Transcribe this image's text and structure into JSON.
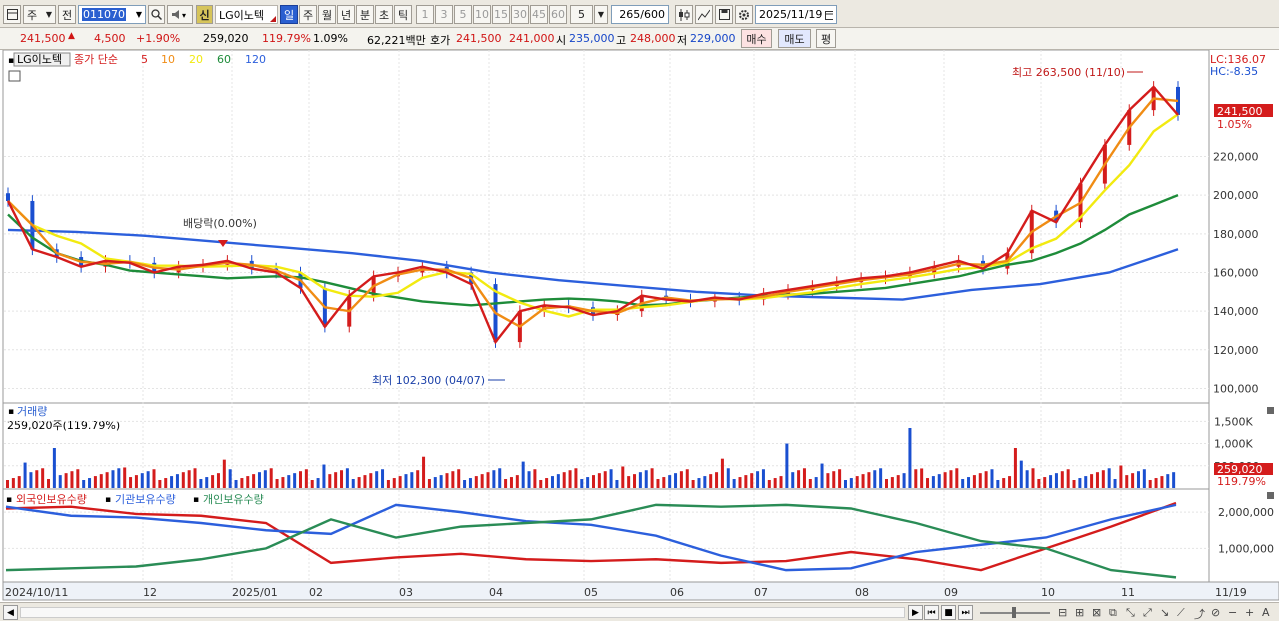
{
  "toolbar": {
    "period_label": "주",
    "prev_label": "전",
    "code_value": "011070",
    "stock_label": "신",
    "stock_name": "LG이노텍",
    "period_buttons": [
      "일",
      "주",
      "월",
      "년",
      "분",
      "초",
      "틱"
    ],
    "minute_buttons": [
      "1",
      "3",
      "5",
      "10",
      "15",
      "30",
      "45",
      "60"
    ],
    "count_value": "5",
    "count_display": "265",
    "count_total": "/600",
    "date_value": "2025/11/19"
  },
  "quote": {
    "price": "241,500",
    "change": "4,500",
    "change_pct": "+1.90%",
    "volume": "259,020",
    "volume_ratio": "119.79%",
    "turnover_pct": "1.09%",
    "amount": "62,221백만",
    "ask_label": "호가",
    "ask": "241,500",
    "bid": "241,000",
    "open_label": "시",
    "open": "235,000",
    "high_label": "고",
    "high": "248,000",
    "low_label": "저",
    "low": "229,000",
    "buy_label": "매수",
    "sell_label": "매도",
    "eval_label": "평"
  },
  "chart": {
    "legend_name": "LG이노텍",
    "legend_type": "종가 단순",
    "ma_periods": [
      "5",
      "10",
      "20",
      "60",
      "120"
    ],
    "ma_colors": [
      "#d41c1c",
      "#f08c14",
      "#f2ea10",
      "#1e8c3a",
      "#2c5fdc"
    ],
    "lc_label": "LC:136.07",
    "hc_label": "HC:-8.35",
    "current_tag": "241,500",
    "current_pct": "1.05%",
    "max_label": "최고 263,500 (11/10)",
    "min_label": "최저 102,300 (04/07)",
    "dividend_label": "배당락(0.00%)",
    "volume_title": "거래량",
    "volume_value": "259,020주(119.79%)",
    "volume_tag": "259,020",
    "volume_tag_pct": "119.79%",
    "holdings_legend": [
      "외국인보유수량",
      "기관보유수량",
      "개인보유수량"
    ],
    "holdings_colors": [
      "#d41c1c",
      "#2c5fdc",
      "#2a8c56"
    ],
    "dates": [
      "2024/10/11",
      "12",
      "2025/01",
      "02",
      "03",
      "04",
      "05",
      "06",
      "07",
      "08",
      "09",
      "10",
      "11",
      "11/19"
    ]
  },
  "chart_data": [
    {
      "type": "candlestick",
      "title": "LG이노텍",
      "yticks": [
        100000,
        120000,
        140000,
        160000,
        180000,
        200000,
        220000
      ],
      "ylim": [
        93000,
        272000
      ],
      "series": [
        {
          "name": "5",
          "values": [
            197000,
            172000,
            168000,
            163000,
            166000,
            165000,
            160000,
            163000,
            164000,
            166000,
            162000,
            160000,
            152000,
            132000,
            148000,
            158000,
            160000,
            163000,
            160000,
            154000,
            124000,
            140000,
            143000,
            142000,
            138000,
            140000,
            148000,
            146000,
            145000,
            147000,
            146000,
            149000,
            151000,
            153000,
            155000,
            157000,
            158000,
            160000,
            163000,
            166000,
            162000,
            170000,
            192000,
            186000,
            206000,
            226000,
            244000,
            256000,
            241500
          ]
        },
        {
          "name": "120",
          "values": [
            182000,
            181000,
            179000,
            176000,
            173000,
            170000,
            166000,
            160000,
            156000,
            153000,
            150000,
            148000,
            147000,
            146000,
            151000,
            154000,
            160000,
            172000
          ]
        }
      ]
    },
    {
      "type": "bar",
      "title": "거래량",
      "yticks": [
        500000,
        1000000,
        1500000
      ],
      "values": [
        259020
      ]
    },
    {
      "type": "line",
      "yticks": [
        1000000,
        2000000
      ],
      "series": [
        {
          "name": "외국인보유수량",
          "values": [
            2100000,
            2150000,
            1950000,
            1900000,
            1700000,
            600000,
            750000,
            850000,
            700000,
            650000,
            700000,
            600000,
            650000,
            900000,
            700000,
            400000,
            1000000,
            1600000,
            2250000
          ]
        },
        {
          "name": "기관보유수량",
          "values": [
            2150000,
            1900000,
            1850000,
            1700000,
            1500000,
            1400000,
            2200000,
            2000000,
            1750000,
            1650000,
            1350000,
            800000,
            400000,
            450000,
            900000,
            1100000,
            1300000,
            1800000,
            2200000
          ]
        },
        {
          "name": "개인보유수량",
          "values": [
            400000,
            450000,
            500000,
            700000,
            1000000,
            1800000,
            1300000,
            1600000,
            1700000,
            1800000,
            2200000,
            2150000,
            2200000,
            2100000,
            1700000,
            1200000,
            1000000,
            400000,
            200000
          ]
        }
      ]
    }
  ]
}
